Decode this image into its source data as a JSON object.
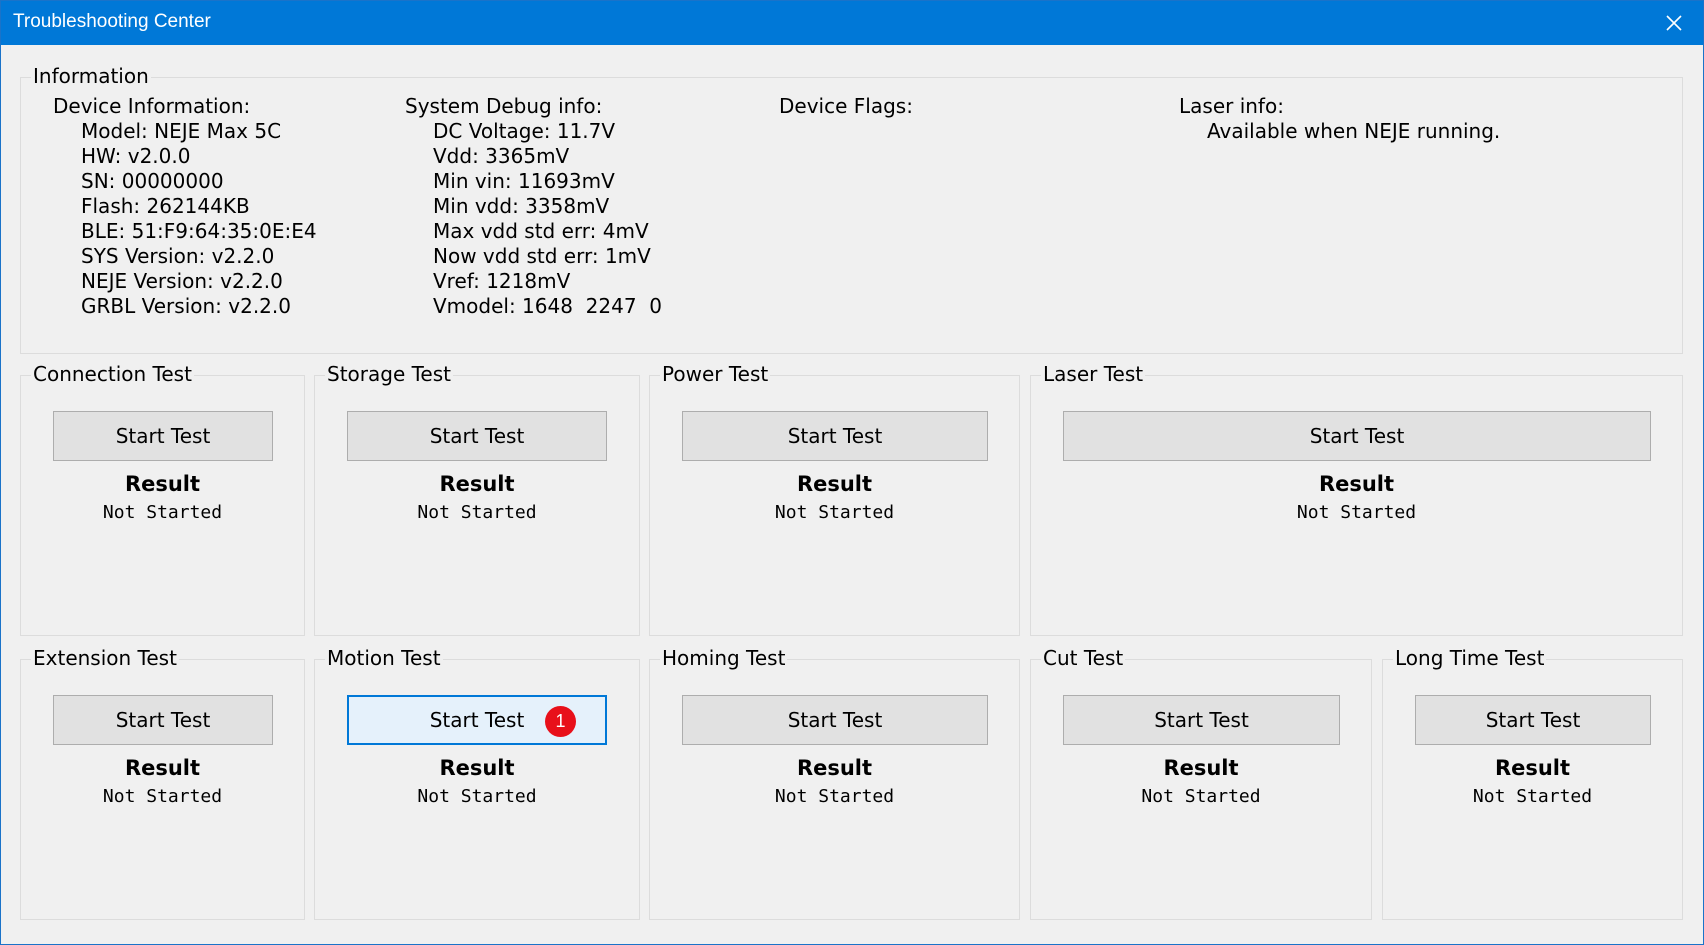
{
  "window": {
    "title": "Troubleshooting Center"
  },
  "information": {
    "title": "Information",
    "device": {
      "heading": "Device Information:",
      "lines": [
        "Model: NEJE Max 5C",
        "HW: v2.0.0",
        "SN: 00000000",
        "Flash: 262144KB",
        "BLE: 51:F9:64:35:0E:E4",
        "SYS Version: v2.2.0",
        "NEJE Version: v2.2.0",
        "GRBL Version: v2.2.0"
      ]
    },
    "debug": {
      "heading": "System Debug info:",
      "lines": [
        "DC Voltage: 11.7V",
        "Vdd: 3365mV",
        "Min vin: 11693mV",
        "Min vdd: 3358mV",
        "Max vdd std err: 4mV",
        "Now vdd std err: 1mV",
        "Vref: 1218mV",
        "Vmodel: 1648  2247  0"
      ]
    },
    "flags": {
      "heading": "Device Flags:"
    },
    "laser": {
      "heading": "Laser info:",
      "lines": [
        "Available when NEJE running."
      ]
    }
  },
  "tests": {
    "start_label": "Start Test",
    "result_label": "Result",
    "items": [
      {
        "title": "Connection Test",
        "status": "Not Started"
      },
      {
        "title": "Storage Test",
        "status": "Not Started"
      },
      {
        "title": "Power Test",
        "status": "Not Started"
      },
      {
        "title": "Laser Test",
        "status": "Not Started"
      },
      {
        "title": "Extension Test",
        "status": "Not Started"
      },
      {
        "title": "Motion Test",
        "status": "Not Started"
      },
      {
        "title": "Homing Test",
        "status": "Not Started"
      },
      {
        "title": "Cut Test",
        "status": "Not Started"
      },
      {
        "title": "Long Time Test",
        "status": "Not Started"
      }
    ]
  },
  "annotation": {
    "badge": "1"
  },
  "colors": {
    "titlebar": "#0078d7",
    "badge": "#e8101a",
    "focus_border": "#0078d7"
  }
}
